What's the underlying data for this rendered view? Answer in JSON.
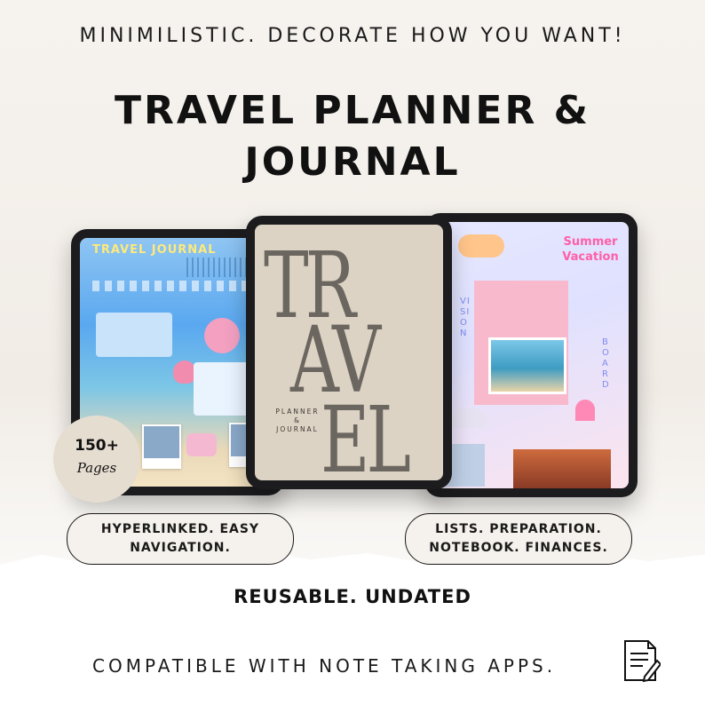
{
  "header": {
    "tagline": "MINIMILISTIC. DECORATE HOW YOU WANT!",
    "title_line1": "TRAVEL PLANNER &",
    "title_line2": "JOURNAL"
  },
  "tablets": {
    "left": {
      "heading": "TRAVEL JOURNAL"
    },
    "center": {
      "cover_line1": "TR",
      "cover_line2": "AV",
      "cover_line3": "EL",
      "subtitle_top": "PLANNER",
      "subtitle_amp": "&",
      "subtitle_bottom": "JOURNAL"
    },
    "right": {
      "heading_line1": "Summer",
      "heading_line2": "Vacation",
      "vertical_left": "VISION",
      "vertical_right": "BOARD"
    }
  },
  "badge": {
    "count": "150+",
    "label": "Pages"
  },
  "features": {
    "left_line1": "HYPERLINKED. EASY",
    "left_line2": "NAVIGATION.",
    "right_line1": "LISTS. PREPARATION.",
    "right_line2": "NOTEBOOK. FINANCES."
  },
  "reusable": "REUSABLE. UNDATED",
  "compatible": "COMPATIBLE WITH NOTE TAKING APPS.",
  "icons": {
    "note": "note-pencil-icon"
  },
  "colors": {
    "background": "#f4f0eb",
    "ink": "#111111",
    "badge": "#e6ddd1",
    "cover": "#ddd3c4",
    "cover_text": "#6b6760"
  }
}
